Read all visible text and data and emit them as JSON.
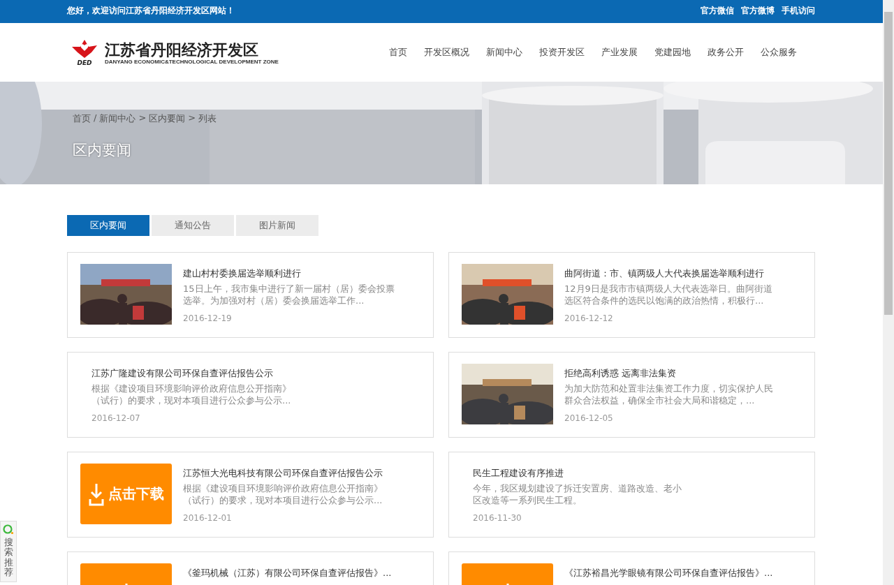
{
  "top_bar": {
    "welcome": "您好，欢迎访问江苏省丹阳经济开发区网站！",
    "links": [
      "官方微信",
      "官方微博",
      "手机访问"
    ]
  },
  "header": {
    "logo": {
      "mark_text": "DED",
      "name": "江苏省丹阳经济开发区",
      "subtitle": "DANYANG ECONOMIC&TECHNOLOGICAL DEVELOPMENT ZONE"
    },
    "nav": [
      {
        "label": "首页",
        "selected": false
      },
      {
        "label": "开发区概况",
        "selected": false
      },
      {
        "label": "新闻中心",
        "selected": false
      },
      {
        "label": "投资开发区",
        "selected": false
      },
      {
        "label": "产业发展",
        "selected": false
      },
      {
        "label": "党建园地",
        "selected": false
      },
      {
        "label": "政务公开",
        "selected": false
      },
      {
        "label": "公众服务",
        "selected": false
      }
    ]
  },
  "banner": {
    "kind": "picture",
    "breadcrumb": [
      {
        "label": "首页"
      },
      {
        "sep": "/",
        "label": "新闻中心"
      },
      {
        "sep": ">",
        "label": "区内要闻"
      },
      {
        "sep": ">",
        "label": "列表"
      }
    ],
    "title": "区内要闻"
  },
  "tabs": [
    {
      "label": "区内要闻",
      "selected": true
    },
    {
      "label": "通知公告",
      "selected": false
    },
    {
      "label": "图片新闻",
      "selected": false
    }
  ],
  "news": [
    {
      "title": "建山村村委换届选举顺利进行",
      "summary": "15日上午，我市集中进行了新一届村（居）委会投票选举。为加强对村（居）委会换届选举工作...",
      "date": "2016-12-19"
    },
    {
      "title": "曲阿街道：市、镇两级人大代表换届选举顺利进行",
      "summary": "12月9日是我市市镇两级人大代表选举日。曲阿街道选区符合条件的选民以饱满的政治热情，积极行...",
      "date": "2016-12-12"
    },
    {
      "kind": "text",
      "title": "江苏广隆建设有限公司环保自查评估报告公示",
      "summary": "根据《建设项目环境影响评价政府信息公开指南》（试行）的要求，现对本项目进行公众参与公示...",
      "date": "2016-12-07"
    },
    {
      "title": "拒绝高利诱惑 远离非法集资",
      "summary": "为加大防范和处置非法集资工作力度，切实保护人民群众合法权益，确保全市社会大局和谐稳定，...",
      "date": "2016-12-05"
    },
    {
      "kind": "download",
      "image_text": "点击下载",
      "title": "江苏恒大光电科技有限公司环保自查评估报告公示",
      "summary": "根据《建设项目环境影响评价政府信息公开指南》（试行）的要求，现对本项目进行公众参与公示...",
      "date": "2016-12-01"
    },
    {
      "kind": "text",
      "title": "民生工程建设有序推进",
      "summary": "今年，我区规划建设了拆迁安置房、道路改造、老小区改造等一系列民生工程。",
      "date": "2016-11-30"
    },
    {
      "kind": "download",
      "title": "《釜玛机械（江苏）有限公司环保自查评估报告》..."
    },
    {
      "kind": "download",
      "title": "《江苏裕昌光学眼镜有限公司环保自查评估报告》..."
    }
  ],
  "side_widget": {
    "label": "搜索推荐"
  }
}
